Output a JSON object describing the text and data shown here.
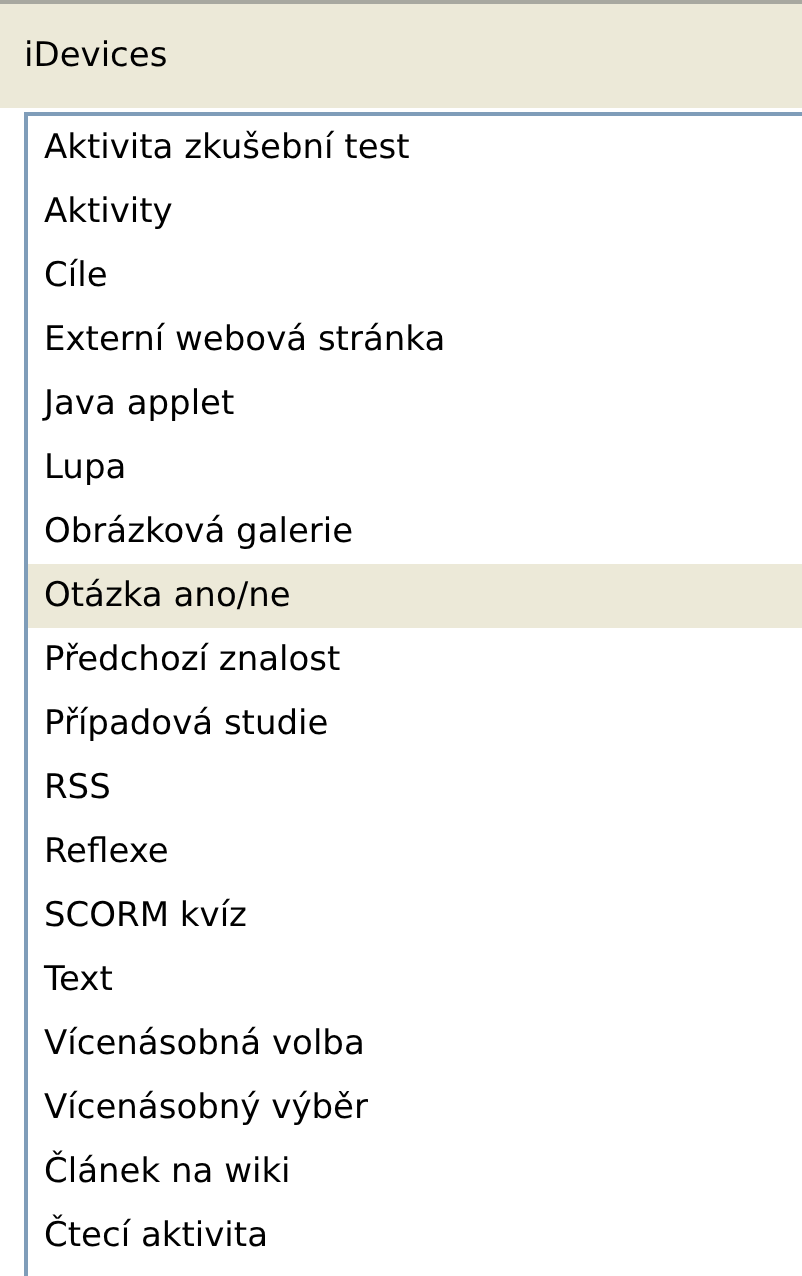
{
  "panel": {
    "title": "iDevices"
  },
  "items": [
    {
      "label": "Aktivita zkušební test",
      "selected": false
    },
    {
      "label": "Aktivity",
      "selected": false
    },
    {
      "label": "Cíle",
      "selected": false
    },
    {
      "label": "Externí webová stránka",
      "selected": false
    },
    {
      "label": "Java applet",
      "selected": false
    },
    {
      "label": "Lupa",
      "selected": false
    },
    {
      "label": "Obrázková galerie",
      "selected": false
    },
    {
      "label": "Otázka ano/ne",
      "selected": true
    },
    {
      "label": "Předchozí znalost",
      "selected": false
    },
    {
      "label": "Případová studie",
      "selected": false
    },
    {
      "label": "RSS",
      "selected": false
    },
    {
      "label": "Reflexe",
      "selected": false
    },
    {
      "label": "SCORM kvíz",
      "selected": false
    },
    {
      "label": "Text",
      "selected": false
    },
    {
      "label": "Vícenásobná volba",
      "selected": false
    },
    {
      "label": "Vícenásobný výběr",
      "selected": false
    },
    {
      "label": "Článek na wiki",
      "selected": false
    },
    {
      "label": "Čtecí aktivita",
      "selected": false
    }
  ]
}
